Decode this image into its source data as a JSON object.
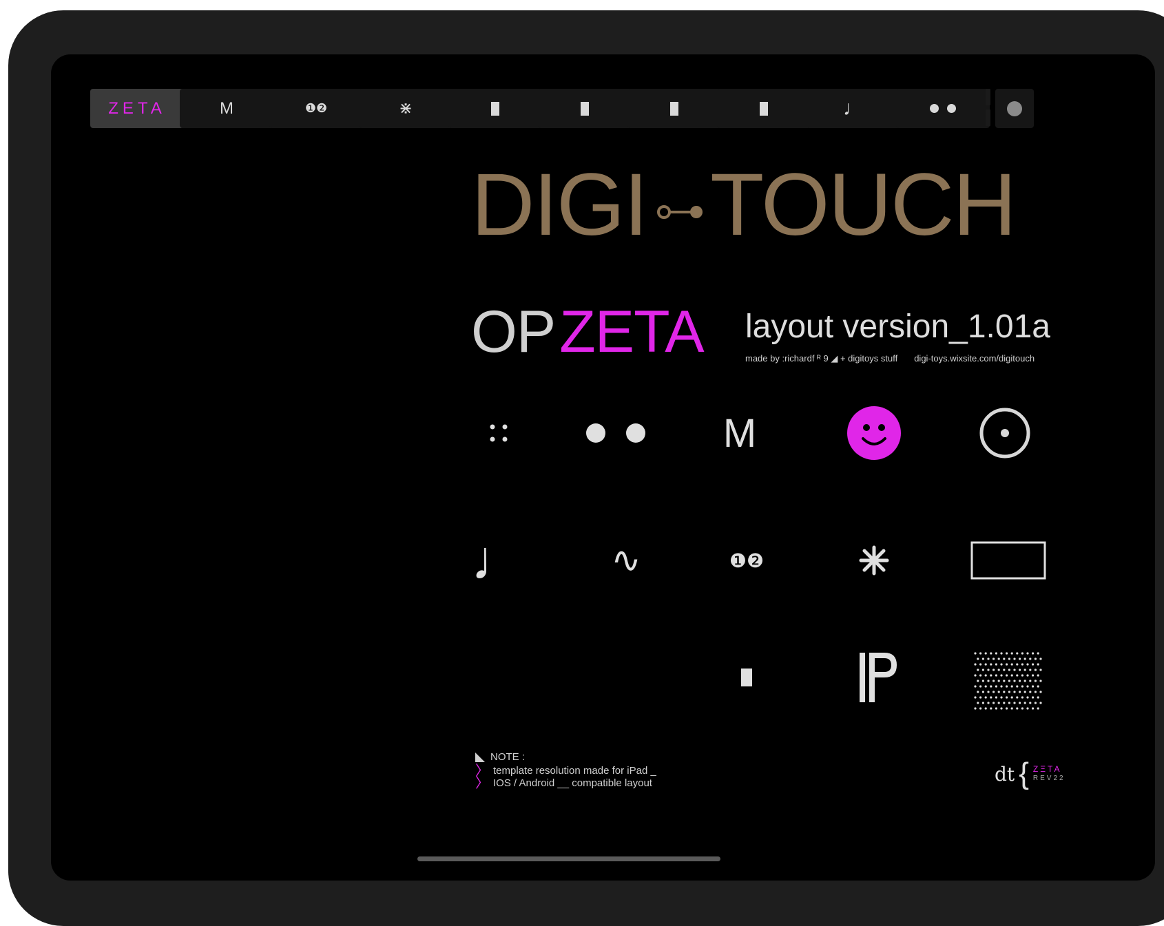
{
  "toolbar": {
    "tabs": [
      {
        "label": "ZETA",
        "icon": "text"
      },
      {
        "label": "M",
        "icon": "text"
      },
      {
        "label": "❶❷",
        "icon": "text"
      },
      {
        "label": "⋇",
        "icon": "asterisk-icon"
      },
      {
        "label": "",
        "icon": "bar-icon"
      },
      {
        "label": "",
        "icon": "bar-icon"
      },
      {
        "label": "",
        "icon": "bar-icon"
      },
      {
        "label": "",
        "icon": "bar-icon"
      },
      {
        "label": "♩",
        "icon": "text"
      },
      {
        "label": "",
        "icon": "two-dots-icon"
      }
    ]
  },
  "title": {
    "left": "DIGI",
    "right": "TOUCH",
    "op": "OP",
    "zeta": "ZETA",
    "version": "layout version_1.01a",
    "credit_left": "made by :richardf ᴿ 9 ◢ + digitoys stuff",
    "credit_right": "digi-toys.wixsite.com/digitouch"
  },
  "grid": {
    "m_label": "M",
    "numbers_label": "❶❷",
    "note_label": "♩",
    "wave_label": "∿",
    "asterisk_label": "⋇"
  },
  "note": {
    "heading": "NOTE :",
    "line1": "template resolution made for iPad _",
    "line2": "IOS / Android __ compatible layout"
  },
  "brand": {
    "logo": "dt",
    "line1": "ZΞTA",
    "line2": "REV22"
  },
  "colors": {
    "accent": "#e026e8",
    "title_gold": "#8b7355",
    "text": "#e0e0e0"
  }
}
